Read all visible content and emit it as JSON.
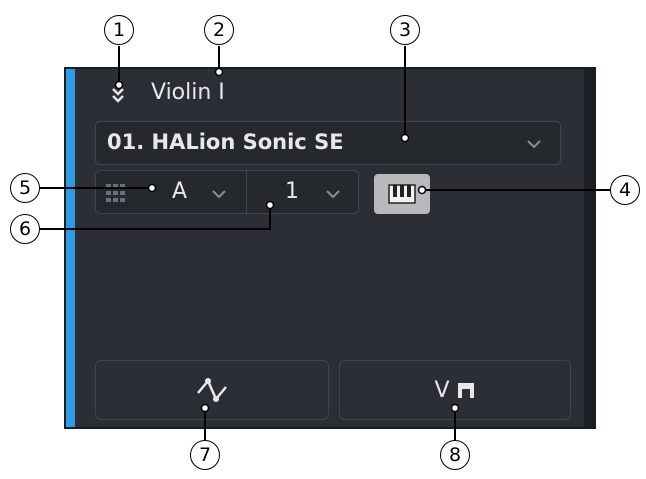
{
  "track": {
    "name": "Violin I",
    "collapse_icon": "chevron-double-down-icon"
  },
  "device": {
    "selected": "01. HALion Sonic SE"
  },
  "port": {
    "icon": "grid-icon",
    "selected": "A"
  },
  "channel": {
    "selected": "1"
  },
  "keyboard_button": {
    "icon": "piano-keys-icon"
  },
  "bottom_buttons": {
    "automation_icon": "automation-curve-icon",
    "vst_icon": "vst-instrument-icon",
    "vst_label": "V"
  },
  "callouts": [
    "1",
    "2",
    "3",
    "4",
    "5",
    "6",
    "7",
    "8"
  ],
  "colors": {
    "accent": "#2e9be3",
    "panel": "#2b2f35",
    "field": "#25292e",
    "text": "#e6e8ea"
  }
}
